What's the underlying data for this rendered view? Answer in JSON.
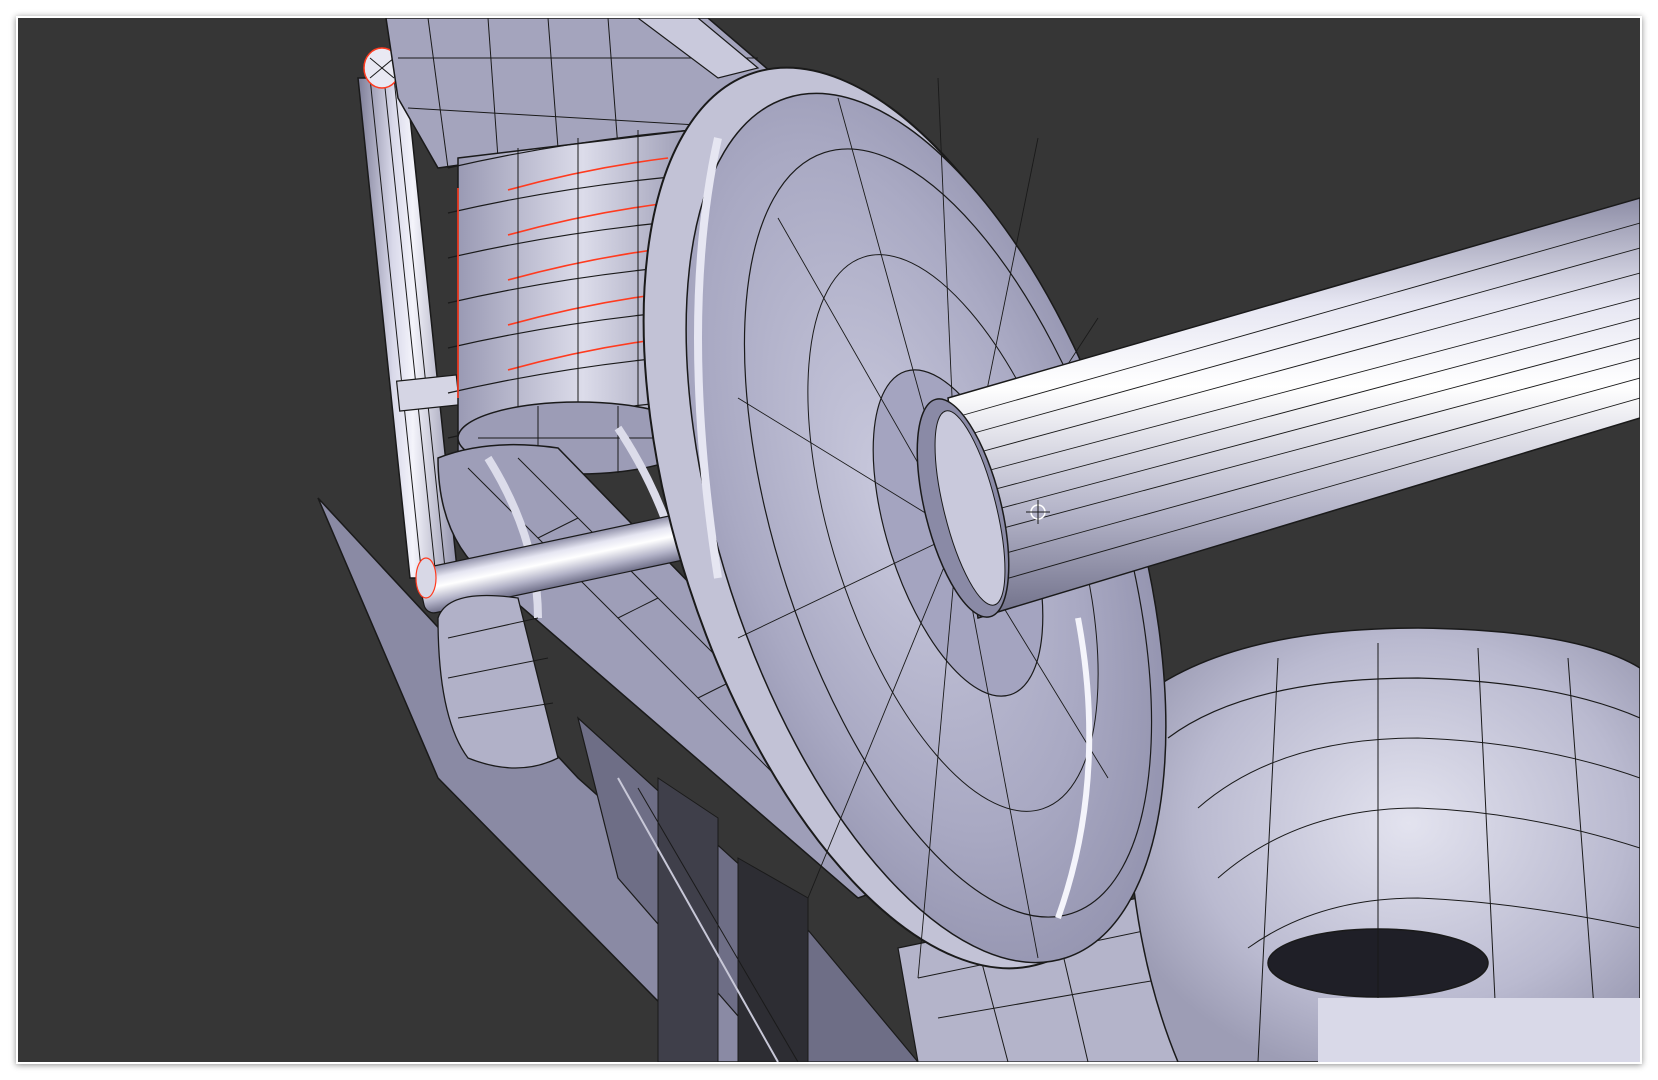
{
  "viewport": {
    "background": "#363636",
    "object_color": "#b7b7cf",
    "wire_color": "#1a1a1a",
    "selected_edge_color": "#ff3b1f"
  },
  "icons": {
    "cursor": "3d-cursor-icon"
  }
}
